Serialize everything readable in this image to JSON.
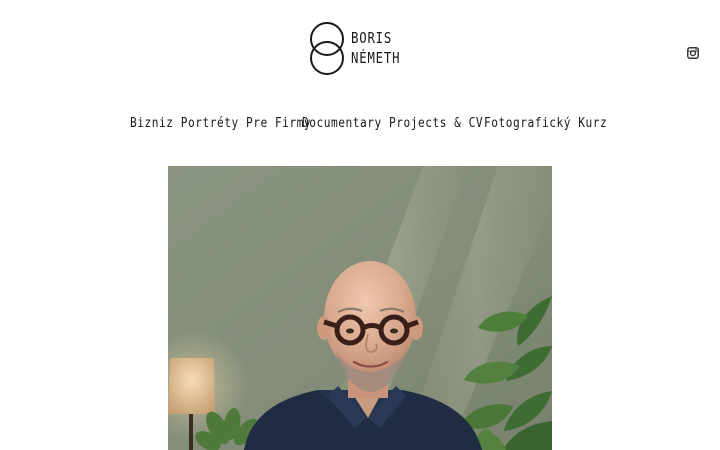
{
  "site": {
    "logo_line1": "BORIS",
    "logo_line2": "NÉMETH"
  },
  "social": {
    "instagram_icon": "instagram-icon"
  },
  "nav": {
    "items": [
      {
        "label": "Bizniz Portréty Pre Firmy"
      },
      {
        "label": "Documentary Projects & CV"
      },
      {
        "label": "Fotografický Kurz"
      }
    ]
  },
  "hero": {
    "subject": "portrait-photo",
    "colors": {
      "wall": "#8a957f",
      "shirt": "#1f2c44",
      "skin": "#d7a98f",
      "plant": "#3d6a35"
    }
  }
}
